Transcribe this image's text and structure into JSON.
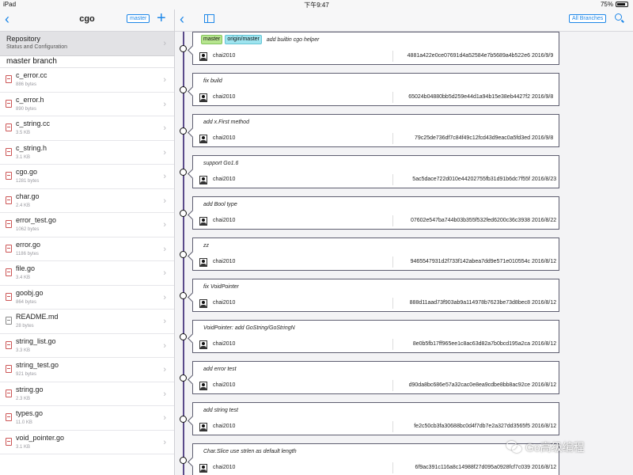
{
  "status_bar": {
    "carrier": "iPad",
    "time": "下午9:47",
    "battery": "75%"
  },
  "sidebar": {
    "title": "cgo",
    "branch_button": "master",
    "repository": {
      "title": "Repository",
      "subtitle": "Status and Configuration"
    },
    "branch_header": "master branch",
    "files": [
      {
        "name": "c_error.cc",
        "size": "886 bytes",
        "icon": "code-file-icon"
      },
      {
        "name": "c_error.h",
        "size": "890 bytes",
        "icon": "code-file-icon"
      },
      {
        "name": "c_string.cc",
        "size": "3.5 KB",
        "icon": "code-file-icon"
      },
      {
        "name": "c_string.h",
        "size": "3.1 KB",
        "icon": "code-file-icon"
      },
      {
        "name": "cgo.go",
        "size": "1281 bytes",
        "icon": "code-file-icon"
      },
      {
        "name": "char.go",
        "size": "2.4 KB",
        "icon": "code-file-icon"
      },
      {
        "name": "error_test.go",
        "size": "1062 bytes",
        "icon": "code-file-icon"
      },
      {
        "name": "error.go",
        "size": "1186 bytes",
        "icon": "code-file-icon"
      },
      {
        "name": "file.go",
        "size": "3.4 KB",
        "icon": "code-file-icon"
      },
      {
        "name": "goobj.go",
        "size": "864 bytes",
        "icon": "code-file-icon"
      },
      {
        "name": "README.md",
        "size": "28 bytes",
        "icon": "document-icon"
      },
      {
        "name": "string_list.go",
        "size": "3.3 KB",
        "icon": "code-file-icon"
      },
      {
        "name": "string_test.go",
        "size": "921 bytes",
        "icon": "code-file-icon"
      },
      {
        "name": "string.go",
        "size": "2.3 KB",
        "icon": "code-file-icon"
      },
      {
        "name": "types.go",
        "size": "11.0 KB",
        "icon": "code-file-icon"
      },
      {
        "name": "void_pointer.go",
        "size": "3.1 KB",
        "icon": "code-file-icon"
      }
    ]
  },
  "main": {
    "all_branches_button": "All Branches",
    "commits": [
      {
        "refs": [
          "master",
          "origin/master"
        ],
        "message": "add builtin cgo helper",
        "author": "chai2010",
        "hash": "4881a422e0ce07691d4a52584e7b5689a4b522e6",
        "date": "2016/9/9"
      },
      {
        "refs": [],
        "message": "fix build",
        "author": "chai2010",
        "hash": "65024b04880bb5d259e44d1a94b15e38eb4427f2",
        "date": "2016/9/8"
      },
      {
        "refs": [],
        "message": "add x.First method",
        "author": "chai2010",
        "hash": "79c25de736df7c84f49c12fcd43d9eac0a5fd3ed",
        "date": "2016/9/8"
      },
      {
        "refs": [],
        "message": "support Go1.6",
        "author": "chai2010",
        "hash": "5ac5dace722d010e44202755fb31d91b6dc7f55f",
        "date": "2016/8/23"
      },
      {
        "refs": [],
        "message": "add Bool type",
        "author": "chai2010",
        "hash": "07602e547ba744b03b355f532fed6200c36c3938",
        "date": "2016/8/22"
      },
      {
        "refs": [],
        "message": "zz",
        "author": "chai2010",
        "hash": "9465547931d2f733f142abea7dd9e571e010554c",
        "date": "2016/8/12"
      },
      {
        "refs": [],
        "message": "fix VoidPointer",
        "author": "chai2010",
        "hash": "888d11aad73f903ab9a114978b7623be73d8bec8",
        "date": "2016/8/12"
      },
      {
        "refs": [],
        "message": "VoidPointer: add GoString/GoStringN",
        "author": "chai2010",
        "hash": "8e0b5fb17ff965ee1c8ac63d82a7b0bcd195a2ca",
        "date": "2016/8/12"
      },
      {
        "refs": [],
        "message": "add error test",
        "author": "chai2010",
        "hash": "d90da8bc686e57a32cac0e8ea9cdbe8bb8ac92ce",
        "date": "2016/8/12"
      },
      {
        "refs": [],
        "message": "add string test",
        "author": "chai2010",
        "hash": "fe2c50cb3fa30688bc0d4f7db7e2a327dd3565f5",
        "date": "2016/8/12"
      },
      {
        "refs": [],
        "message": "Char.Slice use strlen as default length",
        "author": "chai2010",
        "hash": "6f9ac391c116a8c14988f27d095a0928fcf7c039",
        "date": "2016/8/12"
      }
    ]
  },
  "watermark": {
    "text": "Go高级编程",
    "icon": "wechat-icon"
  }
}
